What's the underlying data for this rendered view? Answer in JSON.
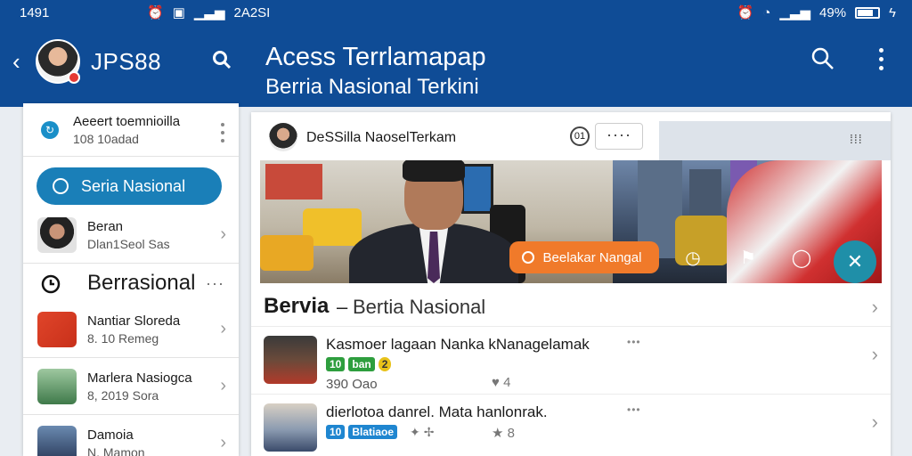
{
  "status": {
    "time": "1491",
    "mid_text": "2A2SI",
    "battery": "49%"
  },
  "appbar": {
    "app_name": "JPS88",
    "title": "Acess Terrlamapap",
    "subtitle": "Berria Nasional Terkini"
  },
  "sidebar": {
    "top_item": {
      "line1": "Aeeert toemnioilla",
      "line2": "108 10adad"
    },
    "primary_button": "Seria Nasional",
    "items": [
      {
        "name": "Beran",
        "meta": "Dlan1Seol Sas"
      },
      {
        "name": "Nantiar Sloreda",
        "meta": "8. 10 Remeg"
      },
      {
        "name": "Marlera Nasiogca",
        "meta": "8, 2019 Sora"
      },
      {
        "name": "Damoia",
        "meta": "N. Mamon"
      }
    ],
    "section_title": "Berrasional"
  },
  "card": {
    "header_title": "DeSSilla NaoselTerkam",
    "relevance_label": "01",
    "more_label": "····",
    "hero_badge": "Beelakar Nangal",
    "section_bold": "Bervia",
    "section_dash": "–",
    "section_rest": "Bertia Nasional",
    "articles": [
      {
        "title": "Kasmoer lagaan Nanka kNanagelamak",
        "tags": [
          "10",
          "ban",
          "2"
        ],
        "meta": "390 Oao",
        "count": "4"
      },
      {
        "title": "dierlotoa danrel. Mata hanlonrak.",
        "tags": [
          "10",
          "Blatiaoe"
        ],
        "meta": "",
        "count": "8"
      }
    ]
  },
  "colors": {
    "appbar": "#0f4c96",
    "accent_blue": "#1a7fb8",
    "orange": "#f07a2a",
    "teal": "#1f8fa8",
    "tag_green": "#2e9e3e",
    "tag_yellow": "#e8c21a",
    "tag_blue": "#1f86d0"
  }
}
